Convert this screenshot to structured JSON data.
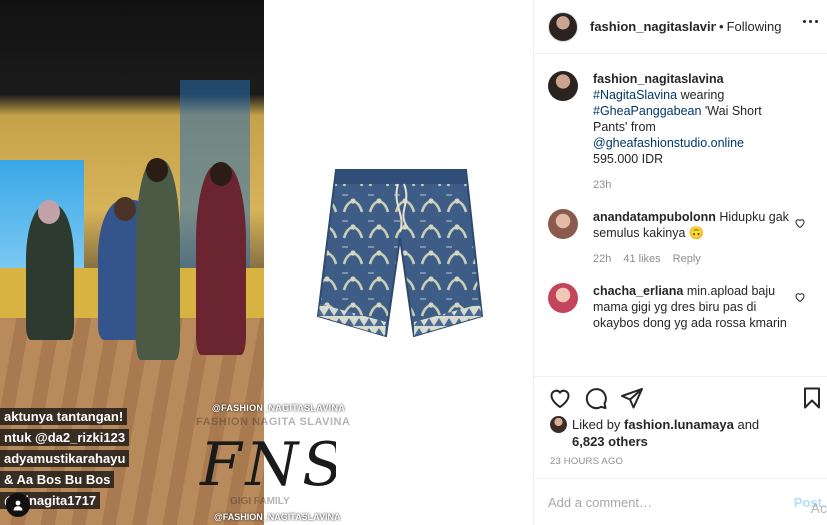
{
  "post": {
    "studio_captions": [
      "aktunya tantangan!",
      "ntuk @da2_rizki123",
      "adyamustikarahayu",
      "& Aa Bos Bu Bos",
      "@ffinagita1717"
    ],
    "watermark_top": "@FASHION_NAGITASLAVINA",
    "watermark_brand": "FASHION NAGITA SLAVINA",
    "logo_text": "FNS",
    "watermark_family": "GIGI FAMILY",
    "watermark_bottom": "@FASHION_NAGITASLAVINA"
  },
  "header": {
    "username": "fashion_nagitaslavina",
    "separator": "•",
    "follow_label": "Following"
  },
  "caption": {
    "username": "fashion_nagitaslavina",
    "tag1": "#NagitaSlavina",
    "text1": " wearing ",
    "tag2": "#GheaPanggabean",
    "text2": " 'Wai Short Pants' from ",
    "tag3": "@gheafashionstudio.online",
    "text3": " 595.000 IDR",
    "time": "23h"
  },
  "comments": [
    {
      "username": "anandatampubolonn",
      "text": "Hidupku gak semulus kakinya 🙃",
      "time": "22h",
      "likes": "41 likes",
      "reply": "Reply"
    },
    {
      "username": "chacha_erliana",
      "text": "min.apload baju mama gigi yg dres biru pas di okaybos dong yg ada rossa kmarin"
    }
  ],
  "likes": {
    "prefix": "Liked by ",
    "user": "fashion.lunamaya",
    "mid": " and",
    "count": "6,823 others"
  },
  "timestamp": "23 HOURS AGO",
  "comment_box": {
    "placeholder": "Add a comment…",
    "post_label": "Post"
  },
  "activation_mark": "Ac",
  "icons": {
    "like": "heart-icon",
    "comment": "comment-icon",
    "share": "paper-plane-icon",
    "save": "bookmark-icon",
    "more": "more-options-icon"
  },
  "colors": {
    "link": "#00376b",
    "muted": "#8e8e8e",
    "post_button": "#b2dffc",
    "border": "#efefef"
  }
}
